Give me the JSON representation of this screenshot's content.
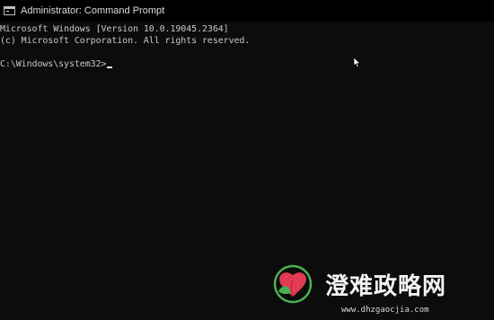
{
  "window": {
    "title": "Administrator: Command Prompt",
    "icon": "cmd-icon"
  },
  "console": {
    "lines": [
      "Microsoft Windows [Version 10.0.19045.2364]",
      "(c) Microsoft Corporation. All rights reserved."
    ],
    "prompt": "C:\\Windows\\system32>",
    "input": ""
  },
  "watermark": {
    "text": "澄难政略网",
    "url": "www.dhzgaocjia.com",
    "logo": "heart-leaf-logo"
  },
  "colors": {
    "background": "#0c0c0c",
    "titlebar": "#000000",
    "text": "#c8c8c8"
  }
}
